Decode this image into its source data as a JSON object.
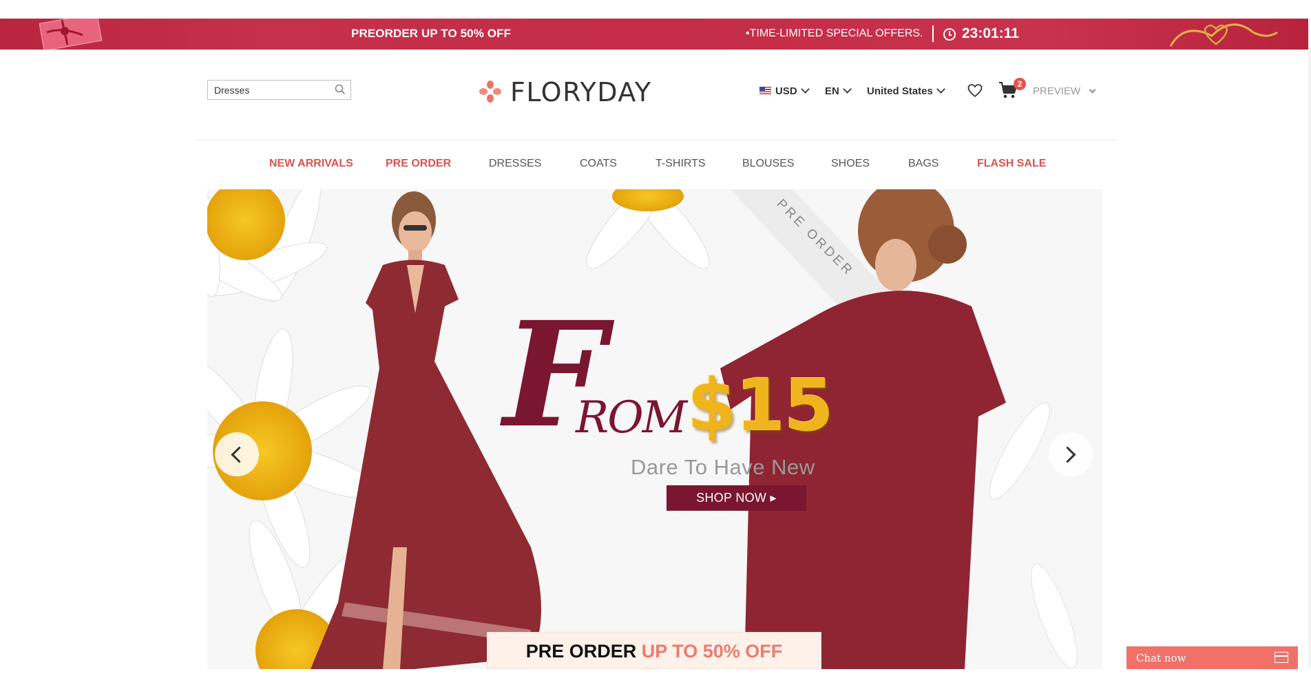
{
  "promo_bar": {
    "preorder_text": "PREORDER UP TO 50% OFF",
    "limited_text": "•TIME-LIMITED SPECIAL OFFERS.",
    "timer": "23:01:11"
  },
  "header": {
    "search": {
      "value": "Dresses",
      "placeholder": "Dresses"
    },
    "logo_text": "FLORYDAY",
    "currency": "USD",
    "language": "EN",
    "country": "United States",
    "cart_count": "2",
    "preview_label": "PREVIEW"
  },
  "nav": {
    "items": [
      {
        "label": "NEW ARRIVALS",
        "highlight": true
      },
      {
        "label": "PRE ORDER",
        "highlight": true
      },
      {
        "label": "DRESSES",
        "highlight": false
      },
      {
        "label": "COATS",
        "highlight": false
      },
      {
        "label": "T-SHIRTS",
        "highlight": false
      },
      {
        "label": "BLOUSES",
        "highlight": false
      },
      {
        "label": "SHOES",
        "highlight": false
      },
      {
        "label": "BAGS",
        "highlight": false
      },
      {
        "label": "FLASH SALE",
        "highlight": true
      }
    ]
  },
  "hero": {
    "headline_initial": "F",
    "headline_rest": "ROM",
    "price": "$15",
    "tagline": "Dare To Have New",
    "cta": "SHOP NOW ▸",
    "ribbon": "PRE ORDER",
    "preorder_box_prefix": "PRE ORDER",
    "preorder_box_accent": "UP TO 50% OFF"
  },
  "chat": {
    "label": "Chat now"
  },
  "colors": {
    "promo_red": "#c42c47",
    "accent_red": "#d9534f",
    "burgundy": "#7a1630",
    "gold": "#f0b41c",
    "chat_coral": "#f07168"
  },
  "icons": [
    "search-icon",
    "logo-flower-icon",
    "us-flag-icon",
    "chevron-down-icon",
    "heart-icon",
    "cart-icon",
    "clock-icon",
    "chevron-left-icon",
    "chevron-right-icon",
    "chat-window-icon"
  ]
}
